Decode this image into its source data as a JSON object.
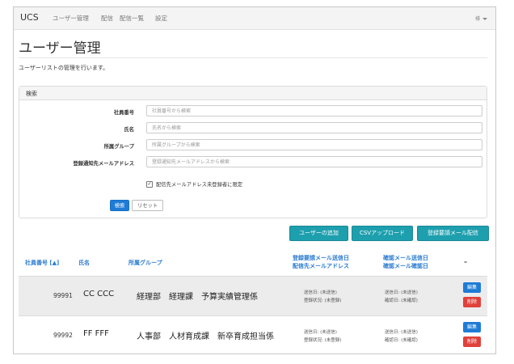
{
  "navbar": {
    "brand": "UCS",
    "items": [
      "ユーザー管理",
      "配信",
      "配信一覧",
      "設定"
    ],
    "user": "様"
  },
  "page": {
    "title": "ユーザー管理",
    "description": "ユーザーリストの管理を行います。"
  },
  "search": {
    "heading": "検索",
    "fields": [
      {
        "label": "社員番号",
        "placeholder": "社員番号から検索"
      },
      {
        "label": "氏名",
        "placeholder": "氏名から検索"
      },
      {
        "label": "所属グループ",
        "placeholder": "所属グループから検索"
      },
      {
        "label": "登録通知先メールアドレス",
        "placeholder": "登録通知先メールアドレスから検索"
      }
    ],
    "checkbox_label": "配信先メールアドレス未登録者に限定",
    "checkbox_checked": true,
    "search_button": "検索",
    "reset_button": "リセット"
  },
  "actions": {
    "add_user": "ユーザーの追加",
    "csv_upload": "CSVアップロード",
    "send_registration": "登録要請メール配信"
  },
  "table": {
    "headers": {
      "employee_no": "社員番号 [▲]",
      "name": "氏名",
      "group": "所属グループ",
      "registration_line1": "登録要請メール送信日",
      "registration_line2": "配信先メールアドレス",
      "confirm_line1": "確認メール送信日",
      "confirm_line2": "確認メール確認日",
      "ops": "–"
    },
    "rows": [
      {
        "employee_no": "99991",
        "name": "CC CCC",
        "group": "経理部　経理課　予算実績管理係",
        "sent": "送信日: (未送信)",
        "status": "登録状況: (未登録)",
        "confirm_sent": "送信日: (未送信)",
        "confirm_date": "確認日: (未確認)",
        "edit": "編集",
        "delete": "削除"
      },
      {
        "employee_no": "99992",
        "name": "FF FFF",
        "group": "人事部　人材育成課　新卒育成担当係",
        "sent": "送信日: (未送信)",
        "status": "登録状況: (未登録)",
        "confirm_sent": "送信日: (未送信)",
        "confirm_date": "確認日: (未確認)",
        "edit": "編集",
        "delete": "削除"
      }
    ]
  },
  "colors": {
    "primary": "#1e7bd6",
    "teal": "#1d9fae",
    "danger": "#e0413b",
    "link": "#2a7bd0"
  }
}
